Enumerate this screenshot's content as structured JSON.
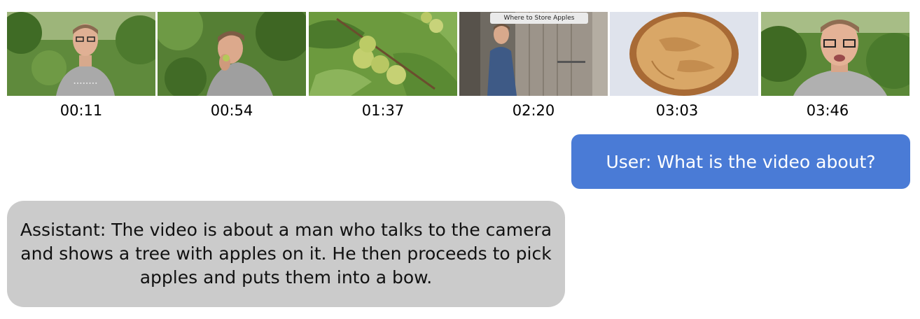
{
  "timeline": {
    "frames": [
      {
        "timestamp": "00:11"
      },
      {
        "timestamp": "00:54"
      },
      {
        "timestamp": "01:37"
      },
      {
        "timestamp": "02:20",
        "caption": "Where to Store Apples"
      },
      {
        "timestamp": "03:03"
      },
      {
        "timestamp": "03:46"
      }
    ]
  },
  "chat": {
    "user_message": "User: What is the video about?",
    "assistant_message": "Assistant: The video is about a man who talks to the camera and shows a tree with apples on it. He then proceeds to pick apples and puts them into a bow."
  },
  "colors": {
    "user_bubble": "#4a7bd6",
    "assistant_bubble": "#cbcbcb"
  }
}
